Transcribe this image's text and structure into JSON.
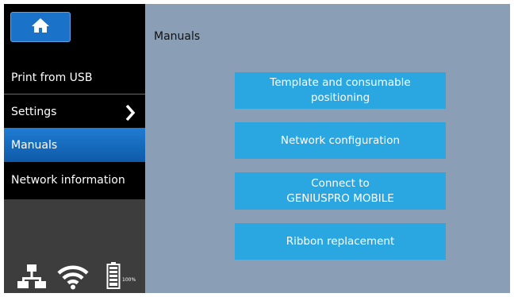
{
  "sidebar": {
    "items": [
      {
        "label": "Print from USB"
      },
      {
        "label": "Settings"
      },
      {
        "label": "Manuals"
      },
      {
        "label": "Network information"
      }
    ],
    "battery_percent": "100%"
  },
  "main": {
    "title": "Manuals",
    "buttons": [
      {
        "line1": "Template and consumable",
        "line2": "positioning"
      },
      {
        "line1": "Network configuration"
      },
      {
        "line1": "Connect to",
        "line2": "GENIUSPRO MOBILE"
      },
      {
        "line1": "Ribbon replacement"
      }
    ]
  },
  "colors": {
    "content_bg": "#8a9fb5",
    "accent_button": "#2aa7e0",
    "active_item": "#1b73c9",
    "sidebar_bg": "#3d3d3d"
  },
  "icons": [
    "home-icon",
    "chevron-right-icon",
    "network-icon",
    "wifi-icon",
    "battery-icon"
  ]
}
